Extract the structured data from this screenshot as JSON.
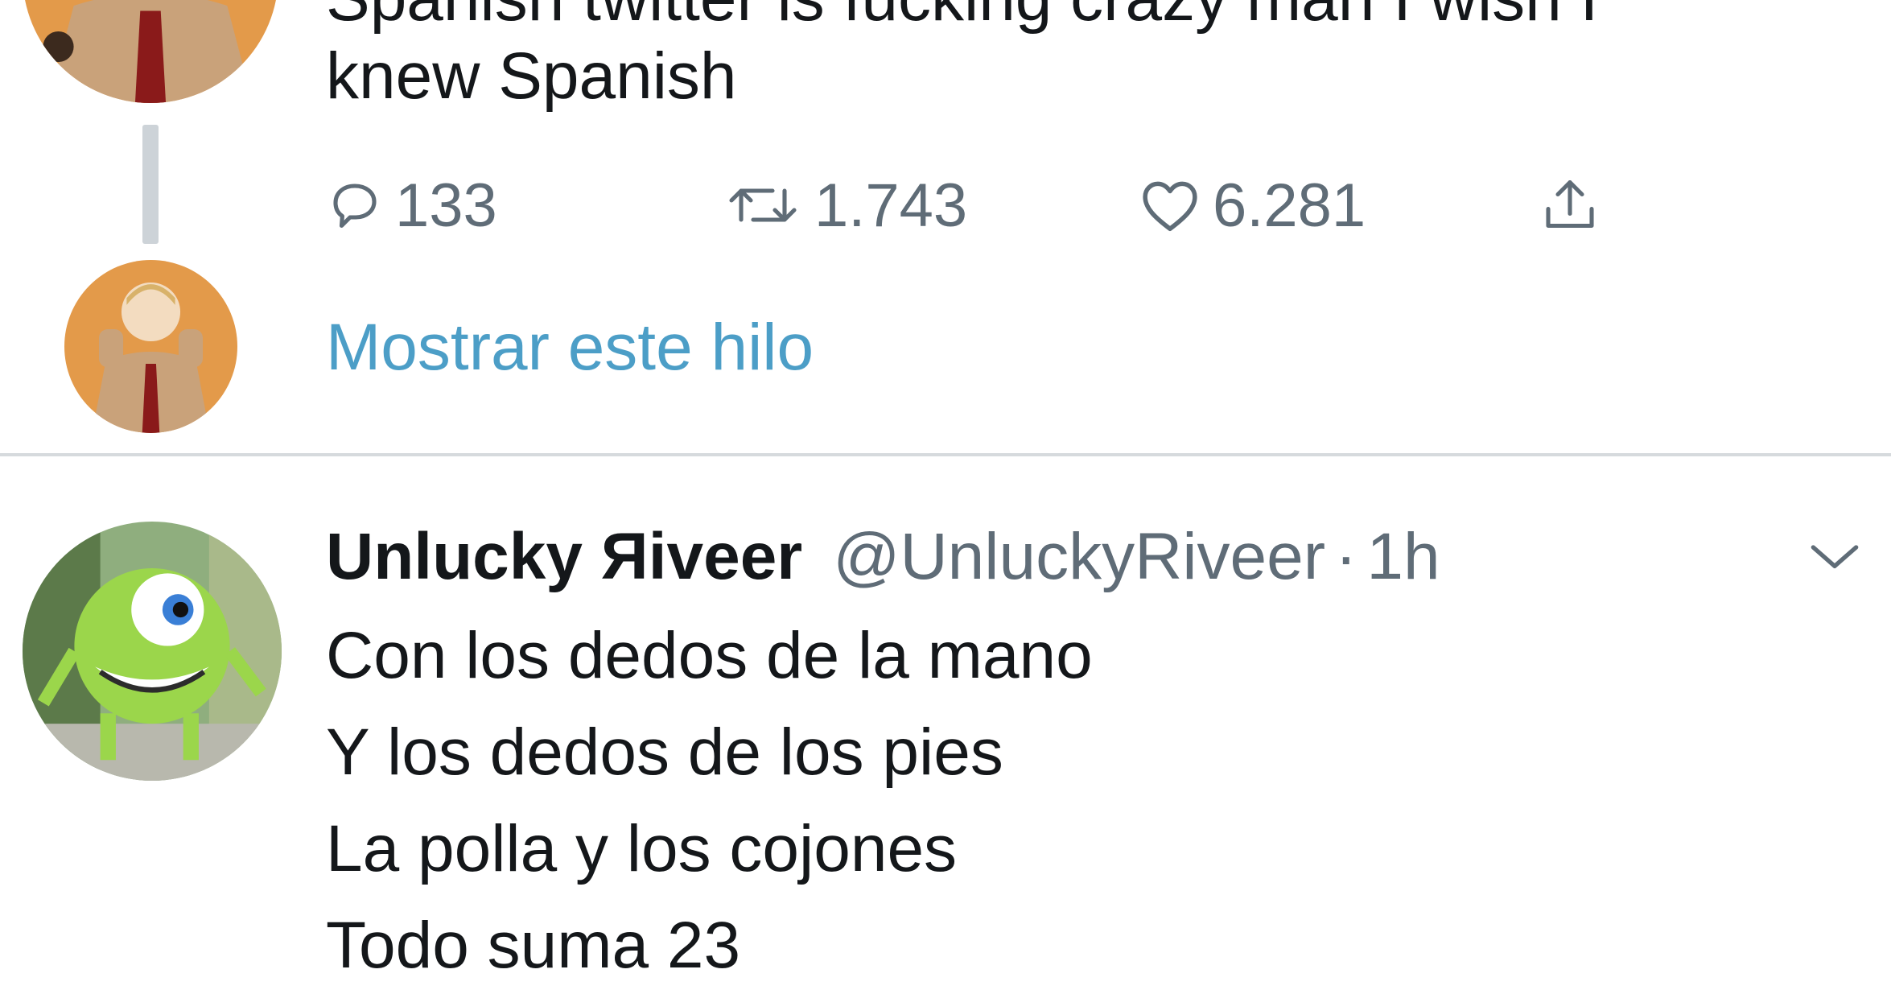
{
  "top_tweet": {
    "text_line_1": "Spanish twitter is fucking crazy man I wish I",
    "text_line_2": "knew Spanish",
    "actions": {
      "reply_count": "133",
      "retweet_count": "1.743",
      "like_count": "6.281"
    },
    "show_thread_label": "Mostrar este hilo"
  },
  "reply_tweet": {
    "display_name": "Unlucky Яiveer",
    "handle": "@UnluckyRiveer",
    "separator": "·",
    "time": "1h",
    "lines": [
      "Con los dedos de la mano",
      "Y los dedos de los pies",
      "La polla y los cojones",
      "Todo suma 23"
    ]
  },
  "icons": {
    "reply": "speech-bubble-icon",
    "retweet": "retweet-icon",
    "like": "heart-icon",
    "share": "share-icon",
    "more": "chevron-down-icon"
  },
  "colors": {
    "link": "#4c9ec7",
    "secondary_text": "#5f6c77",
    "primary_text": "#14171a",
    "divider": "#d6dadd"
  }
}
